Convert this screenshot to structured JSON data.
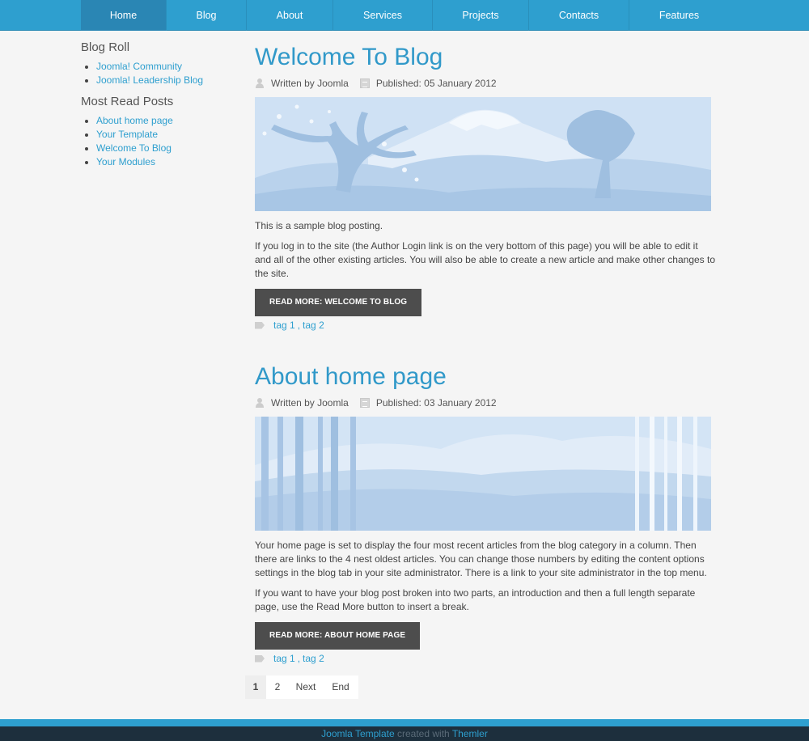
{
  "nav": {
    "items": [
      "Home",
      "Blog",
      "About",
      "Services",
      "Projects",
      "Contacts",
      "Features"
    ],
    "active": "Home"
  },
  "sidebar": {
    "blog_roll": {
      "title": "Blog Roll",
      "items": [
        "Joomla! Community",
        "Joomla! Leadership Blog"
      ]
    },
    "most_read": {
      "title": "Most Read Posts",
      "items": [
        "About home page",
        "Your Template",
        "Welcome To Blog",
        "Your Modules"
      ]
    }
  },
  "articles": [
    {
      "title": "Welcome To Blog",
      "author": "Written by Joomla",
      "published": "Published: 05 January 2012",
      "paragraphs": [
        "This is a sample blog posting.",
        "If you log in to the site (the Author Login link is on the very bottom of this page) you will be able to edit it and all of the other existing articles. You will also be able to create a new article and make other changes to the site."
      ],
      "read_more": "Read more: Welcome To Blog",
      "tags": [
        "tag 1",
        "tag 2"
      ]
    },
    {
      "title": "About home page",
      "author": "Written by Joomla",
      "published": "Published: 03 January 2012",
      "paragraphs": [
        "Your home page is set to display the four most recent articles from the blog category in a column. Then there are links to the 4 nest oldest articles. You can change those numbers by editing the content options settings in the blog tab in your site administrator. There is a link to your site administrator in the top menu.",
        "If you want to have your blog post broken into two parts, an introduction and then a full length separate page, use the Read More button to insert a break."
      ],
      "read_more": "Read more: About home page",
      "tags": [
        "tag 1",
        "tag 2"
      ]
    }
  ],
  "pagination": [
    "1",
    "2",
    "Next",
    "End"
  ],
  "footer": {
    "link1": "Joomla Template",
    "middle": "created with",
    "link2": "Themler"
  },
  "colors": {
    "accent": "#2e9fcf",
    "button": "#4d4d4d",
    "footer_bg": "#1d2f3d"
  }
}
